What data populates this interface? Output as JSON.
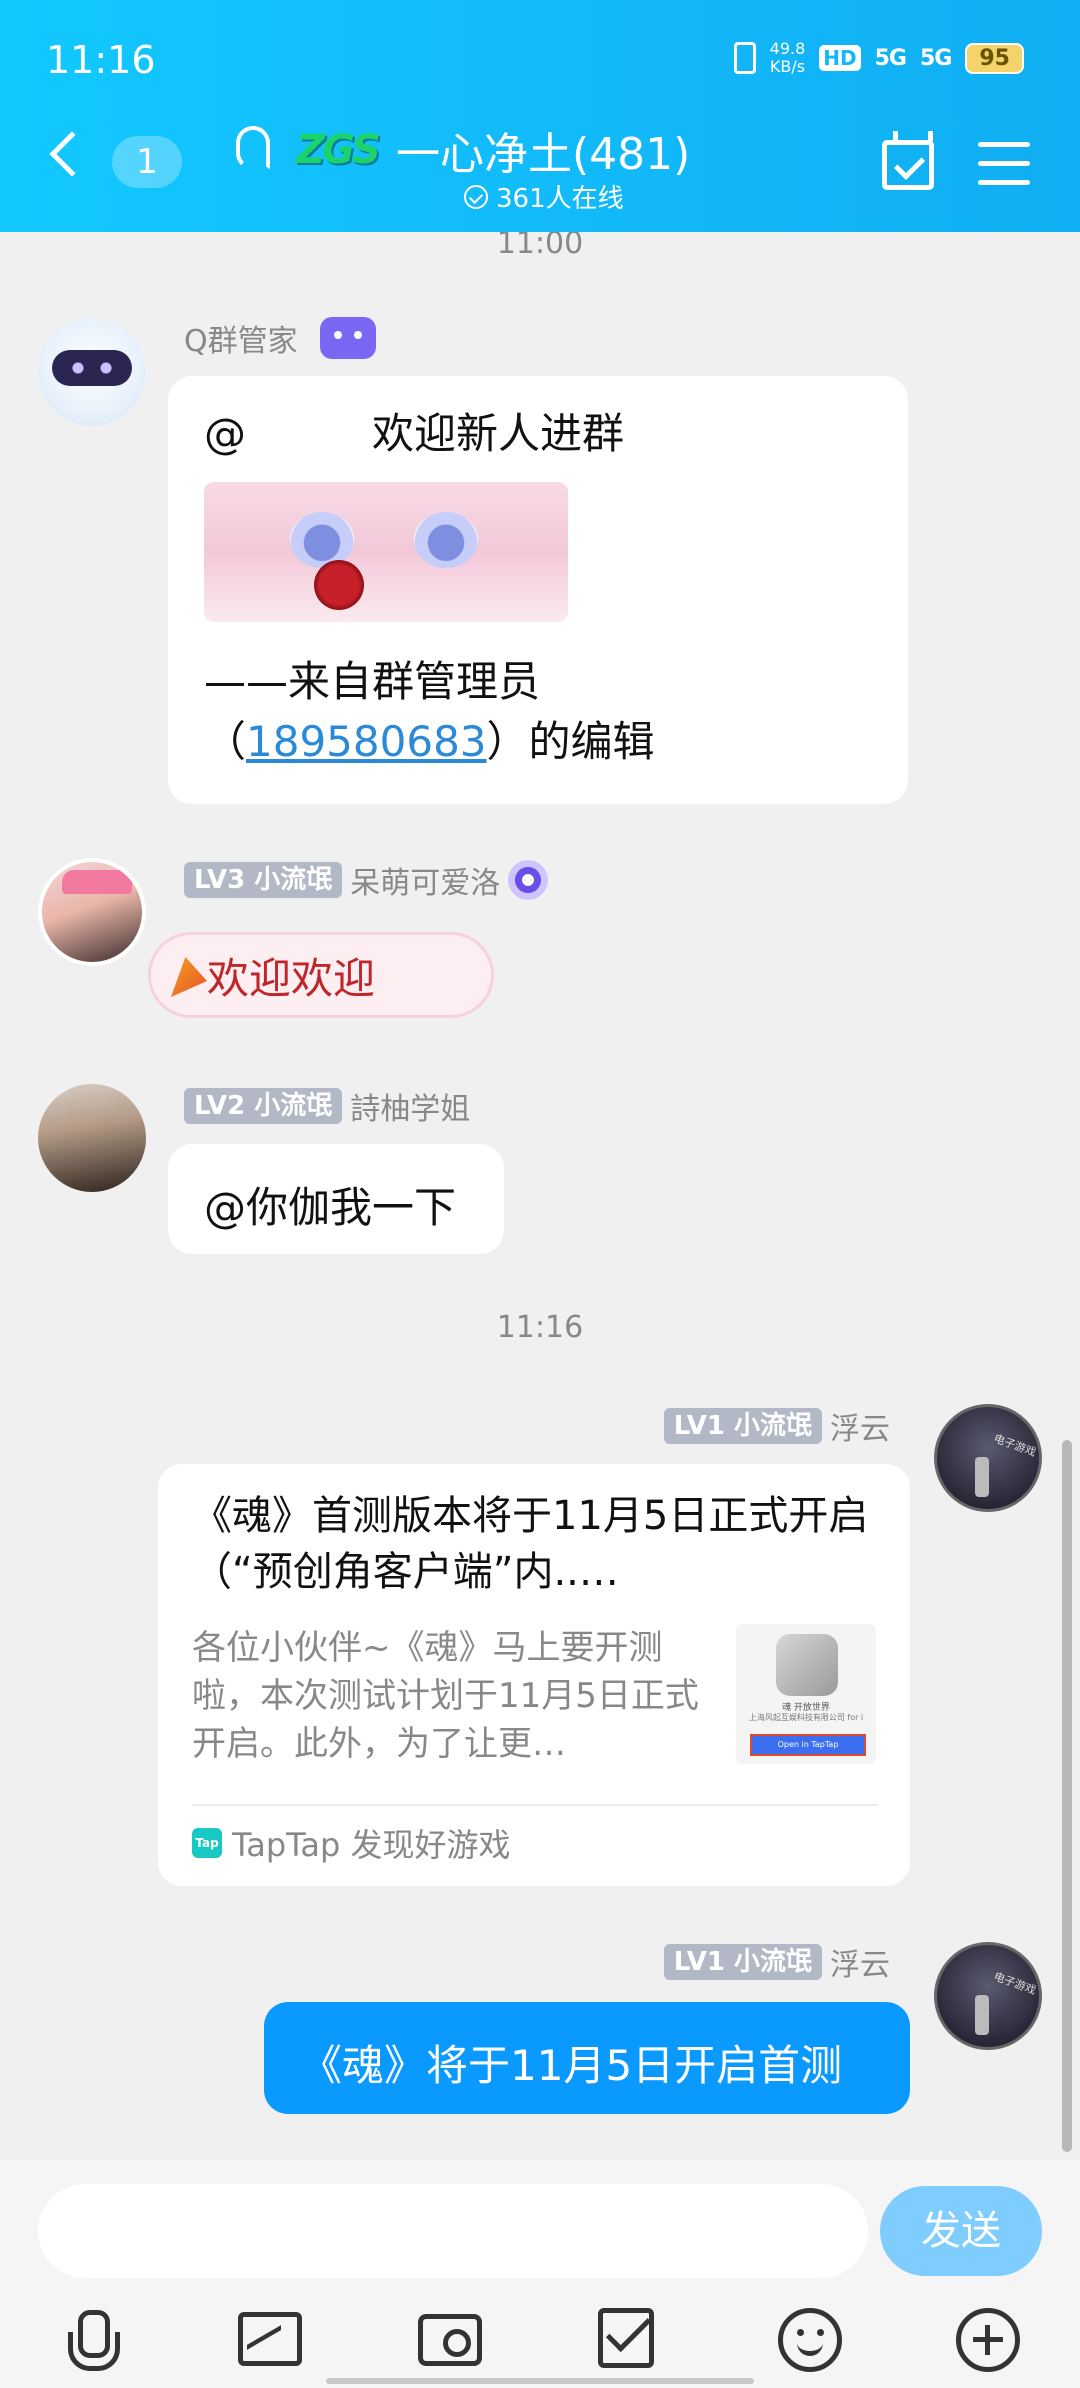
{
  "status_bar": {
    "time": "11:16",
    "speed_value": "49.8",
    "speed_unit": "KB/s",
    "hd": "HD",
    "sim1": "5G",
    "sim2": "5G",
    "battery": "95"
  },
  "header": {
    "unread_count": "1",
    "group_logo": "ZGS",
    "group_name": "一心净土(481)",
    "online": "361人在线"
  },
  "messages": {
    "time1": "11:00",
    "time2": "11:16",
    "bot": {
      "name": "Q群管家",
      "line1": "@　　　欢迎新人进群",
      "line2": "——来自群管理员",
      "line3_prefix": "（",
      "line3_link": "189580683",
      "line3_suffix": "）的编辑"
    },
    "msg2": {
      "level": "LV3 小流氓",
      "name": "呆萌可爱洛",
      "sticker_text": "欢迎欢迎"
    },
    "msg3": {
      "level": "LV2 小流氓",
      "name": "詩柚学姐",
      "text": "@你伽我一下"
    },
    "msg4": {
      "level": "LV1 小流氓",
      "name": "浮云",
      "card_title": "《魂》首测版本将于11月5日正式开启（“预创角客户端”内..…",
      "card_desc": "各位小伙伴~《魂》马上要开测啦，本次测试计划于11月5日正式开启。此外，为了让更…",
      "thumb_line1": "魂 开放世界",
      "thumb_line2": "上海风起互娱科技有限公司 for i",
      "thumb_button": "Open in TapTap",
      "source_icon": "Tap",
      "source": "TapTap 发现好游戏"
    },
    "msg5": {
      "level": "LV1 小流氓",
      "name": "浮云",
      "text": "《魂》将于11月5日开启首测"
    }
  },
  "input": {
    "placeholder": "",
    "send_label": "发送"
  },
  "colors": {
    "header_gradient_start": "#12c8ff",
    "self_bubble": "#0a99ff",
    "send_button": "#7fcdff"
  }
}
